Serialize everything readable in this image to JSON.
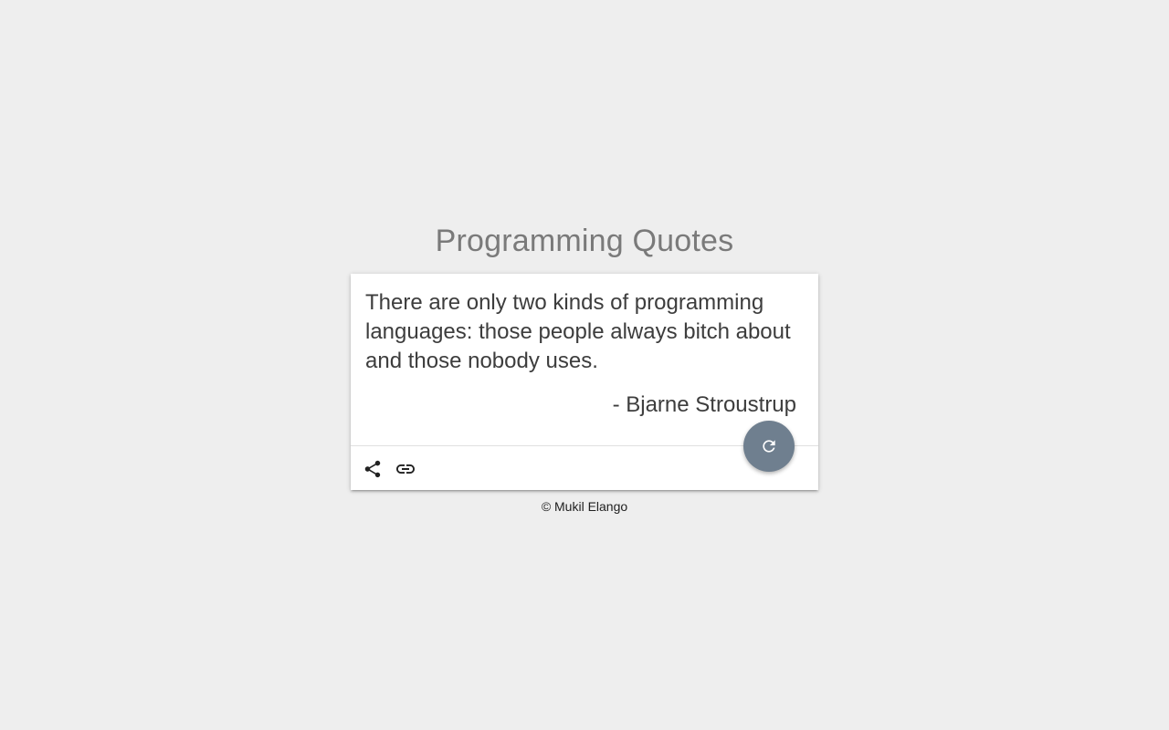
{
  "header": {
    "title": "Programming Quotes"
  },
  "quote": {
    "text": "There are only two kinds of programming languages: those people always bitch about and those nobody uses.",
    "author": "- Bjarne Stroustrup"
  },
  "actions": {
    "share_icon": "share-icon",
    "link_icon": "link-icon",
    "refresh_icon": "refresh-icon"
  },
  "footer": {
    "copyright": "© Mukil Elango"
  },
  "colors": {
    "background": "#eeeeee",
    "title": "#7a7a7a",
    "fab": "#6f7f8f",
    "text": "#3d3d3d"
  }
}
